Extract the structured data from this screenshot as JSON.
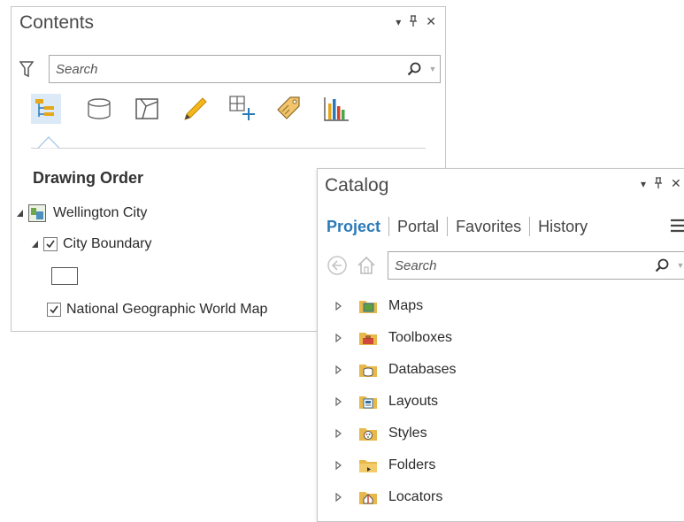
{
  "contents": {
    "title": "Contents",
    "controls": {
      "dropdown": "▾",
      "pin": "⊥",
      "close": "✕"
    },
    "search": {
      "placeholder": "Search"
    },
    "toolbar_icons": [
      "list-by-drawing-order-icon",
      "list-by-source-icon",
      "list-by-selection-icon",
      "list-by-editing-icon",
      "list-by-snapping-icon",
      "list-by-labeling-icon",
      "list-by-charts-icon"
    ],
    "section_title": "Drawing Order",
    "layers": [
      {
        "label": "Wellington City",
        "type": "map",
        "expanded": true
      },
      {
        "label": "City Boundary",
        "type": "layer",
        "checked": true,
        "expanded": true
      },
      {
        "label": "National Geographic World Map",
        "type": "layer",
        "checked": true
      }
    ]
  },
  "catalog": {
    "title": "Catalog",
    "controls": {
      "dropdown": "▾",
      "pin": "⊥",
      "close": "✕"
    },
    "tabs": [
      {
        "label": "Project",
        "active": true
      },
      {
        "label": "Portal",
        "active": false
      },
      {
        "label": "Favorites",
        "active": false
      },
      {
        "label": "History",
        "active": false
      }
    ],
    "menu_icon": "hamburger-menu-icon",
    "search": {
      "placeholder": "Search"
    },
    "items": [
      {
        "label": "Maps",
        "icon": "maps-folder-icon"
      },
      {
        "label": "Toolboxes",
        "icon": "toolboxes-folder-icon"
      },
      {
        "label": "Databases",
        "icon": "databases-folder-icon"
      },
      {
        "label": "Layouts",
        "icon": "layouts-folder-icon"
      },
      {
        "label": "Styles",
        "icon": "styles-folder-icon"
      },
      {
        "label": "Folders",
        "icon": "folders-folder-icon"
      },
      {
        "label": "Locators",
        "icon": "locators-folder-icon"
      }
    ]
  },
  "colors": {
    "accent_blue": "#2a7ab8",
    "folder_yellow": "#e8b84a",
    "border": "#c6c6c6"
  }
}
